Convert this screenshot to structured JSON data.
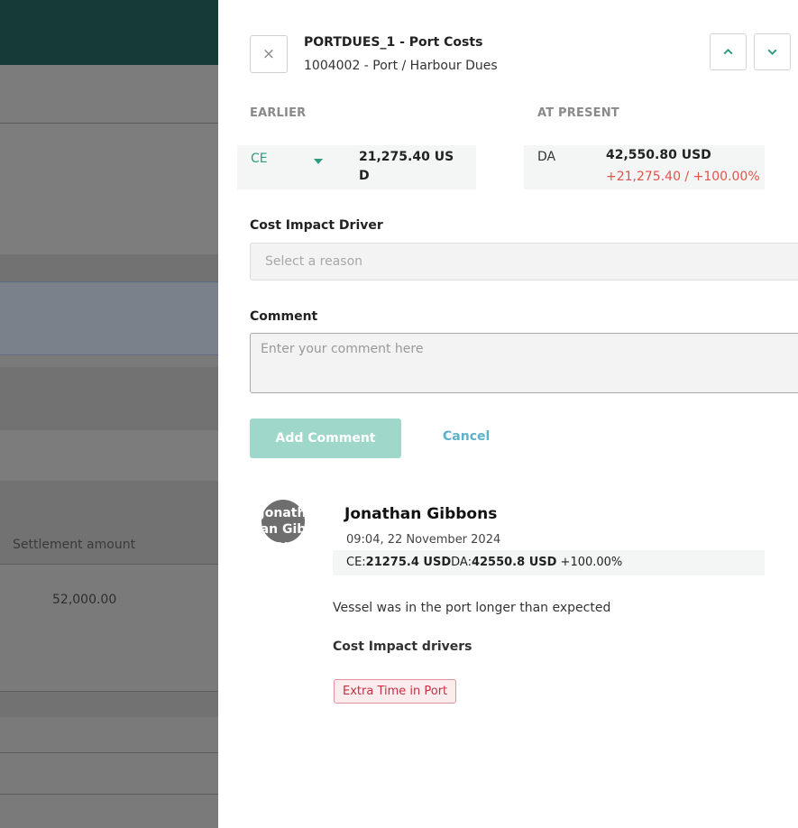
{
  "background": {
    "settlement_label": "Settlement amount",
    "settlement_value": "52,000.00"
  },
  "header": {
    "title": "PORTDUES_1 - Port Costs",
    "subtitle": "1004002 - Port / Harbour Dues",
    "close_icon": "×"
  },
  "comparison": {
    "earlier_heading": "EARLIER",
    "present_heading": "AT PRESENT",
    "earlier_type": "CE",
    "earlier_value": "21,275.40 USD",
    "present_type": "DA",
    "present_value": "42,550.80 USD",
    "present_delta": "+21,275.40 / +100.00%"
  },
  "form": {
    "driver_label": "Cost Impact Driver",
    "driver_placeholder": "Select a reason",
    "comment_label": "Comment",
    "comment_placeholder": "Enter your comment here",
    "add_label": "Add Comment",
    "cancel_label": "Cancel"
  },
  "comment_entry": {
    "avatar_text": "Jonathan Gibbons",
    "author": "Jonathan Gibbons",
    "timestamp": "09:04, 22 November 2024",
    "ce_label": "CE:",
    "ce_value": "21275.4 USD",
    "da_label": "DA:",
    "da_value": "42550.8 USD",
    "percent": "+100.00%",
    "text": "Vessel was in the port longer than expected",
    "drivers_label": "Cost Impact drivers",
    "tag": "Extra Time in Port"
  },
  "colors": {
    "accent": "#2e9b80",
    "delta_negative": "#e0544c",
    "button_disabled": "#9fd8cb",
    "link": "#5cb3c9",
    "tag_border": "#e4919a"
  }
}
